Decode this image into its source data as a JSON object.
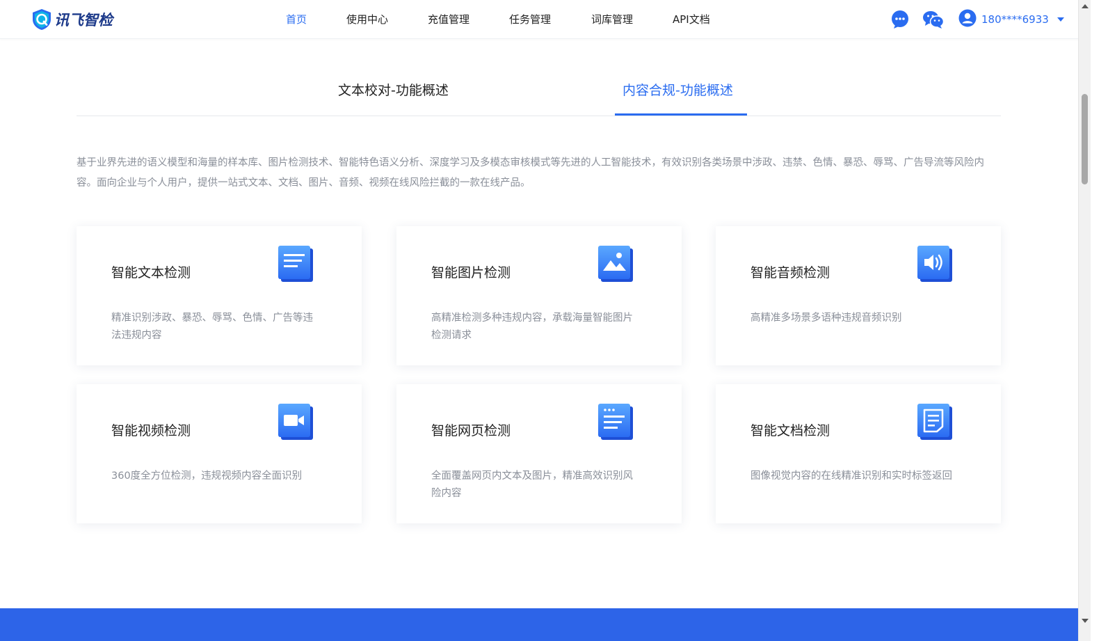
{
  "header": {
    "logo_text": "讯飞智检",
    "nav": [
      {
        "label": "首页",
        "active": true
      },
      {
        "label": "使用中心",
        "active": false
      },
      {
        "label": "充值管理",
        "active": false
      },
      {
        "label": "任务管理",
        "active": false
      },
      {
        "label": "词库管理",
        "active": false
      },
      {
        "label": "API文档",
        "active": false
      }
    ],
    "user_name": "180****6933"
  },
  "tabs": [
    {
      "label": "文本校对-功能概述",
      "active": false
    },
    {
      "label": "内容合规-功能概述",
      "active": true
    }
  ],
  "description": "基于业界先进的语义模型和海量的样本库、图片检测技术、智能特色语义分析、深度学习及多模态审核模式等先进的人工智能技术，有效识别各类场景中涉政、违禁、色情、暴恐、辱骂、广告导流等风险内容。面向企业与个人用户，提供一站式文本、文档、图片、音频、视频在线风险拦截的一款在线产品。",
  "cards": [
    {
      "title": "智能文本检测",
      "text": "精准识别涉政、暴恐、辱骂、色情、广告等违法违规内容",
      "icon": "text-document-icon"
    },
    {
      "title": "智能图片检测",
      "text": "高精准检测多种违规内容，承载海量智能图片检测请求",
      "icon": "image-icon"
    },
    {
      "title": "智能音频检测",
      "text": "高精准多场景多语种违规音频识别",
      "icon": "speaker-icon"
    },
    {
      "title": "智能视频检测",
      "text": "360度全方位检测，违规视频内容全面识别",
      "icon": "video-camera-icon"
    },
    {
      "title": "智能网页检测",
      "text": "全面覆盖网页内文本及图片，精准高效识别风险内容",
      "icon": "webpage-icon"
    },
    {
      "title": "智能文档检测",
      "text": "图像视觉内容的在线精准识别和实时标签返回",
      "icon": "document-icon"
    }
  ],
  "colors": {
    "accent": "#2a6cf0",
    "footer": "#2d64e8",
    "muted_text": "#8a8f99"
  }
}
